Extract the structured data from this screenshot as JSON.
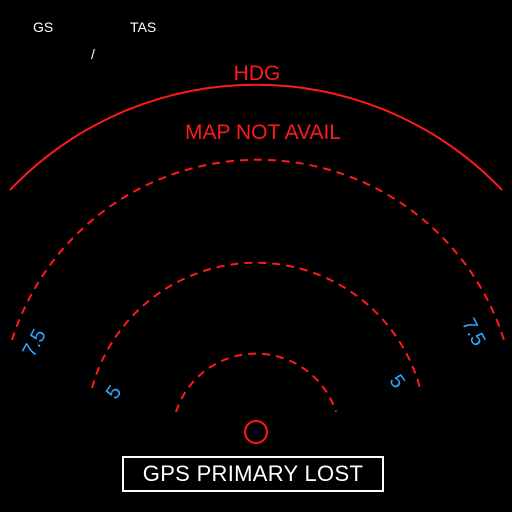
{
  "colors": {
    "white": "#ffffff",
    "red": "#ff1a1a",
    "cyan": "#2ea8ff",
    "background": "#000000"
  },
  "header": {
    "gs_label": "GS",
    "tas_label": "TAS",
    "wind_separator": "/"
  },
  "compass": {
    "hdg_label": "HDG",
    "map_flag": "MAP NOT AVAIL"
  },
  "range_rings": {
    "inner_label": "5",
    "outer_label": "7.5"
  },
  "status": {
    "message": "GPS PRIMARY LOST"
  },
  "icons": {
    "aircraft_symbol": "circle-aircraft-icon"
  }
}
